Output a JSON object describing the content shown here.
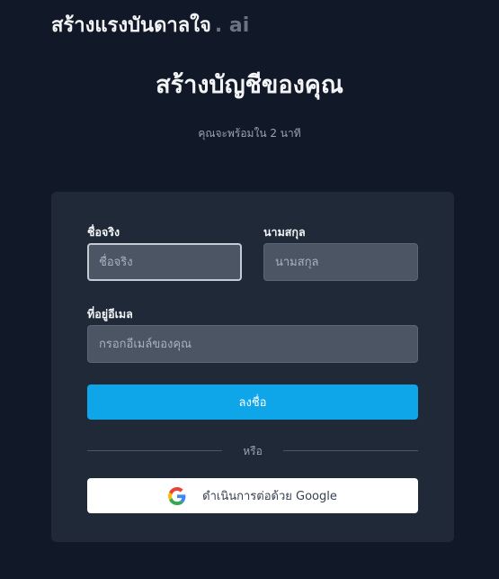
{
  "brand": {
    "name": "สร้างแรงบันดาลใจ",
    "suffix": ". ai"
  },
  "header": {
    "title": "สร้างบัญชีของคุณ",
    "subtitle": "คุณจะพร้อมใน 2 นาที"
  },
  "form": {
    "first_name": {
      "label": "ชื่อจริง",
      "placeholder": "ชื่อจริง",
      "value": ""
    },
    "last_name": {
      "label": "นามสกุล",
      "placeholder": "นามสกุล",
      "value": ""
    },
    "email": {
      "label": "ที่อยู่อีเมล",
      "placeholder": "กรอกอีเมล์ของคุณ",
      "value": ""
    },
    "submit_label": "ลงชื่อ",
    "divider_text": "หรือ",
    "google_label": "ดำเนินการต่อด้วย Google"
  },
  "colors": {
    "background": "#111827",
    "card": "#1f2937",
    "input": "#4b5563",
    "accent": "#0ea5e9"
  },
  "icons": {
    "google": "google-g-icon"
  }
}
